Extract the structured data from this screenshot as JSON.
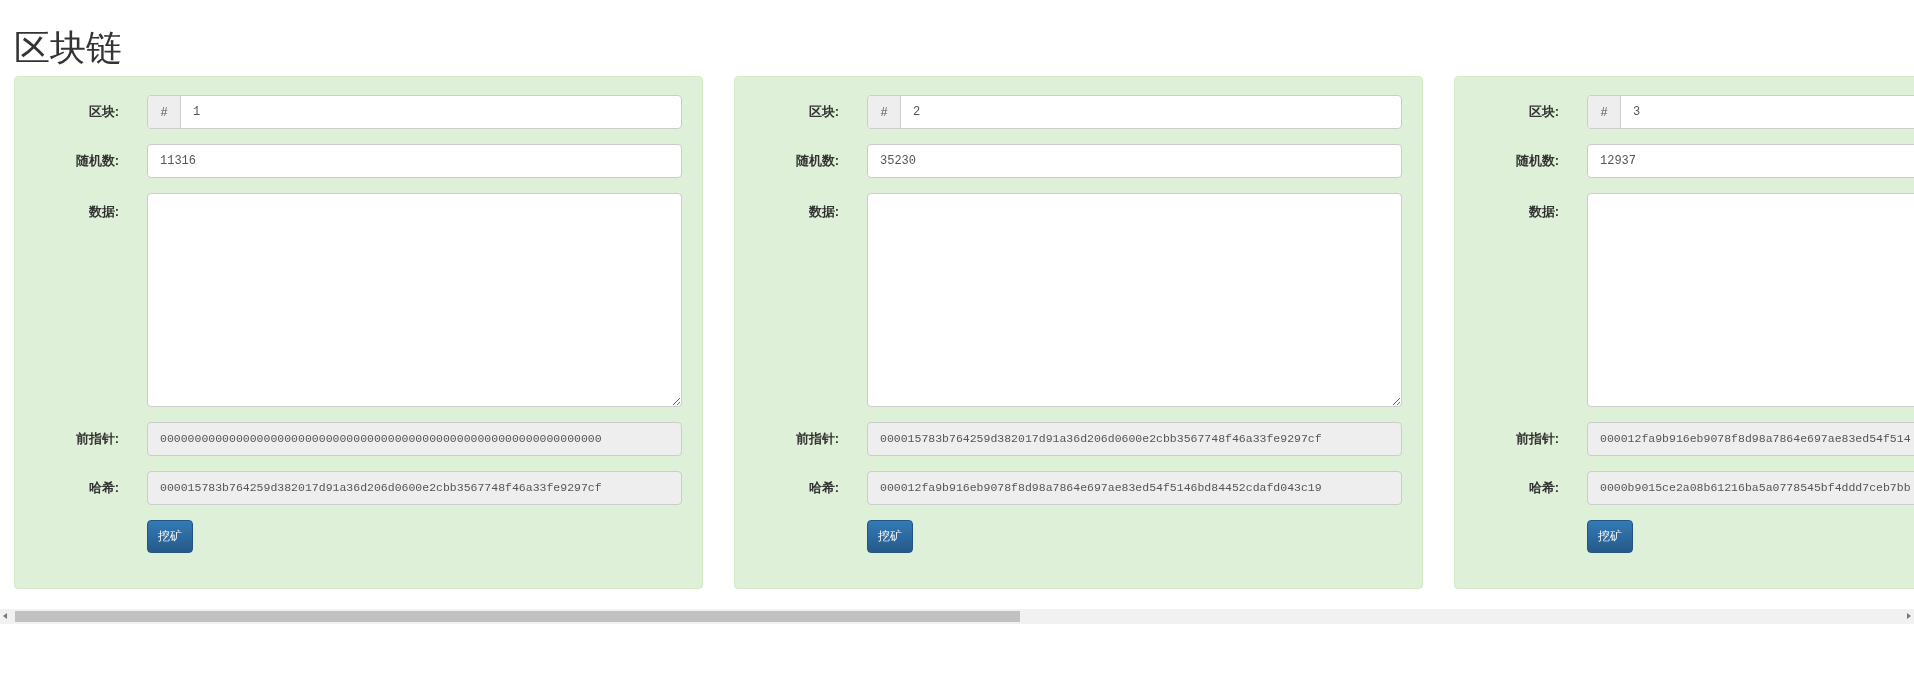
{
  "title": "区块链",
  "blocks": [
    {
      "block_label": "区块:",
      "block_prefix": "#",
      "block": "1",
      "nonce_label": "随机数:",
      "nonce": "11316",
      "data_label": "数据:",
      "prev_label": "前指针:",
      "prev": "0000000000000000000000000000000000000000000000000000000000000000",
      "hash_label": "哈希:",
      "hash": "000015783b764259d382017d91a36d206d0600e2cbb3567748f46a33fe9297cf",
      "button": "挖矿"
    },
    {
      "block_label": "区块:",
      "block_prefix": "#",
      "block": "2",
      "nonce_label": "随机数:",
      "nonce": "35230",
      "data_label": "数据:",
      "prev_label": "前指针:",
      "prev": "000015783b764259d382017d91a36d206d0600e2cbb3567748f46a33fe9297cf",
      "hash_label": "哈希:",
      "hash": "000012fa9b916eb9078f8d98a7864e697ae83ed54f5146bd84452cdafd043c19",
      "button": "挖矿"
    },
    {
      "block_label": "区块:",
      "block_prefix": "#",
      "block": "3",
      "nonce_label": "随机数:",
      "nonce": "12937",
      "data_label": "数据:",
      "prev_label": "前指针:",
      "prev": "000012fa9b916eb9078f8d98a7864e697ae83ed54f514",
      "hash_label": "哈希:",
      "hash": "0000b9015ce2a08b61216ba5a0778545bf4ddd7ceb7bb",
      "button": "挖矿"
    }
  ]
}
